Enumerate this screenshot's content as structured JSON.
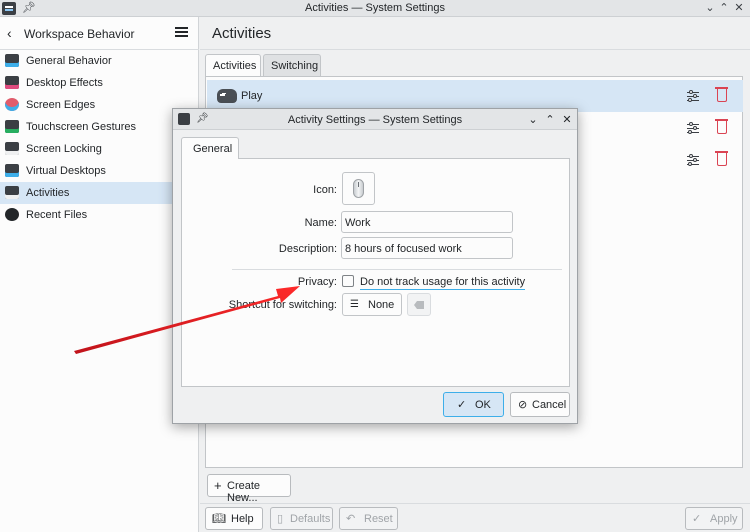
{
  "window": {
    "title": "Activities — System Settings",
    "controls": [
      "⌄",
      "⌃",
      "✕"
    ]
  },
  "sidebar": {
    "title": "Workspace Behavior",
    "back_icon": "chevron-left-icon",
    "menu_icon": "hamburger-menu-icon",
    "items": [
      {
        "label": "General Behavior",
        "icon_color": "#3b3f44",
        "accent": "#3daee9"
      },
      {
        "label": "Desktop Effects",
        "icon_color": "#3b3f44",
        "accent": "#e04c7f"
      },
      {
        "label": "Screen Edges",
        "icon_color": "#e05c6c",
        "accent": "#3daee9"
      },
      {
        "label": "Touchscreen Gestures",
        "icon_color": "#3b3f44",
        "accent": "#27ae60"
      },
      {
        "label": "Screen Locking",
        "icon_color": "#3b3f44",
        "accent": "#eff0f1"
      },
      {
        "label": "Virtual Desktops",
        "icon_color": "#3b3f44",
        "accent": "#3daee9"
      },
      {
        "label": "Activities",
        "icon_color": "#3b3f44",
        "accent": "#eff0f1",
        "active": true
      },
      {
        "label": "Recent Files",
        "icon_color": "#232629",
        "accent": "#ffffff"
      }
    ]
  },
  "main": {
    "title": "Activities",
    "tabs": [
      {
        "label": "Activities",
        "selected": true
      },
      {
        "label": "Switching",
        "selected": false
      }
    ],
    "activity_rows": [
      {
        "label": "Play",
        "highlighted": true
      },
      {
        "label": "",
        "highlighted": false
      },
      {
        "label": "",
        "highlighted": false
      }
    ],
    "create_button": "Create New...",
    "footer": {
      "help": "Help",
      "defaults": "Defaults",
      "reset": "Reset",
      "apply": "Apply"
    }
  },
  "dialog": {
    "title": "Activity Settings — System Settings",
    "tab": "General",
    "fields": {
      "icon_label": "Icon:",
      "name_label": "Name:",
      "name_value": "Work",
      "description_label": "Description:",
      "description_value": "8 hours of focused work",
      "privacy_label": "Privacy:",
      "privacy_checkbox": "Do not track usage for this activity",
      "privacy_checked": false,
      "shortcut_label": "Shortcut for switching:",
      "shortcut_value": "None"
    },
    "ok": "OK",
    "cancel": "Cancel"
  },
  "colors": {
    "accent": "#3daee9",
    "selection": "#d6e6f5",
    "delete": "#da4453",
    "annotation_arrow": "#e8202a"
  }
}
